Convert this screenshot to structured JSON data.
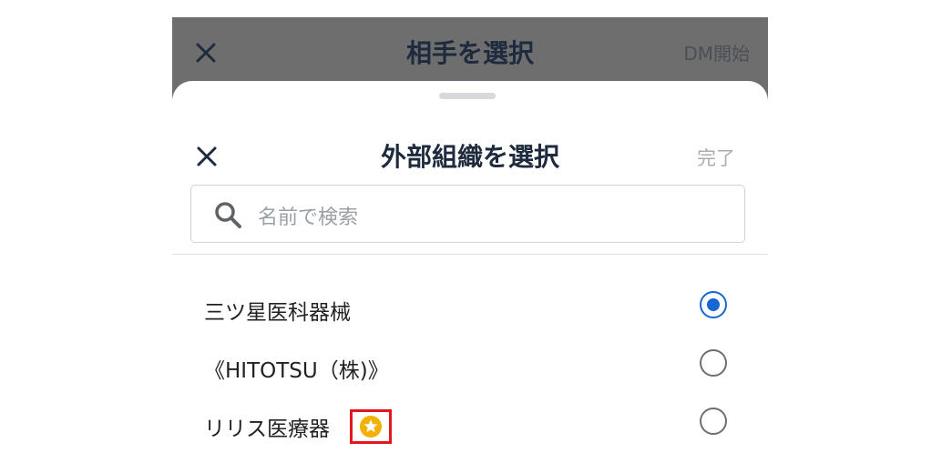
{
  "background_screen": {
    "title": "相手を選択",
    "action_label": "DM開始",
    "close_icon": "close-icon"
  },
  "sheet": {
    "title": "外部組織を選択",
    "done_label": "完了",
    "close_icon": "close-icon",
    "search": {
      "placeholder": "名前で検索",
      "icon": "search-icon"
    },
    "organizations": [
      {
        "name": "三ツ星医科器械",
        "selected": true
      },
      {
        "name": "《HITOTSU（株)》",
        "selected": false
      },
      {
        "name": "リリス医療器",
        "selected": false,
        "badge": "star-icon"
      }
    ]
  },
  "colors": {
    "overlay": "#6e6e6e",
    "title_text": "#1e2a3d",
    "accent_radio": "#1766d1",
    "highlight_box": "#e5161d",
    "star_badge": "#f2b100"
  }
}
